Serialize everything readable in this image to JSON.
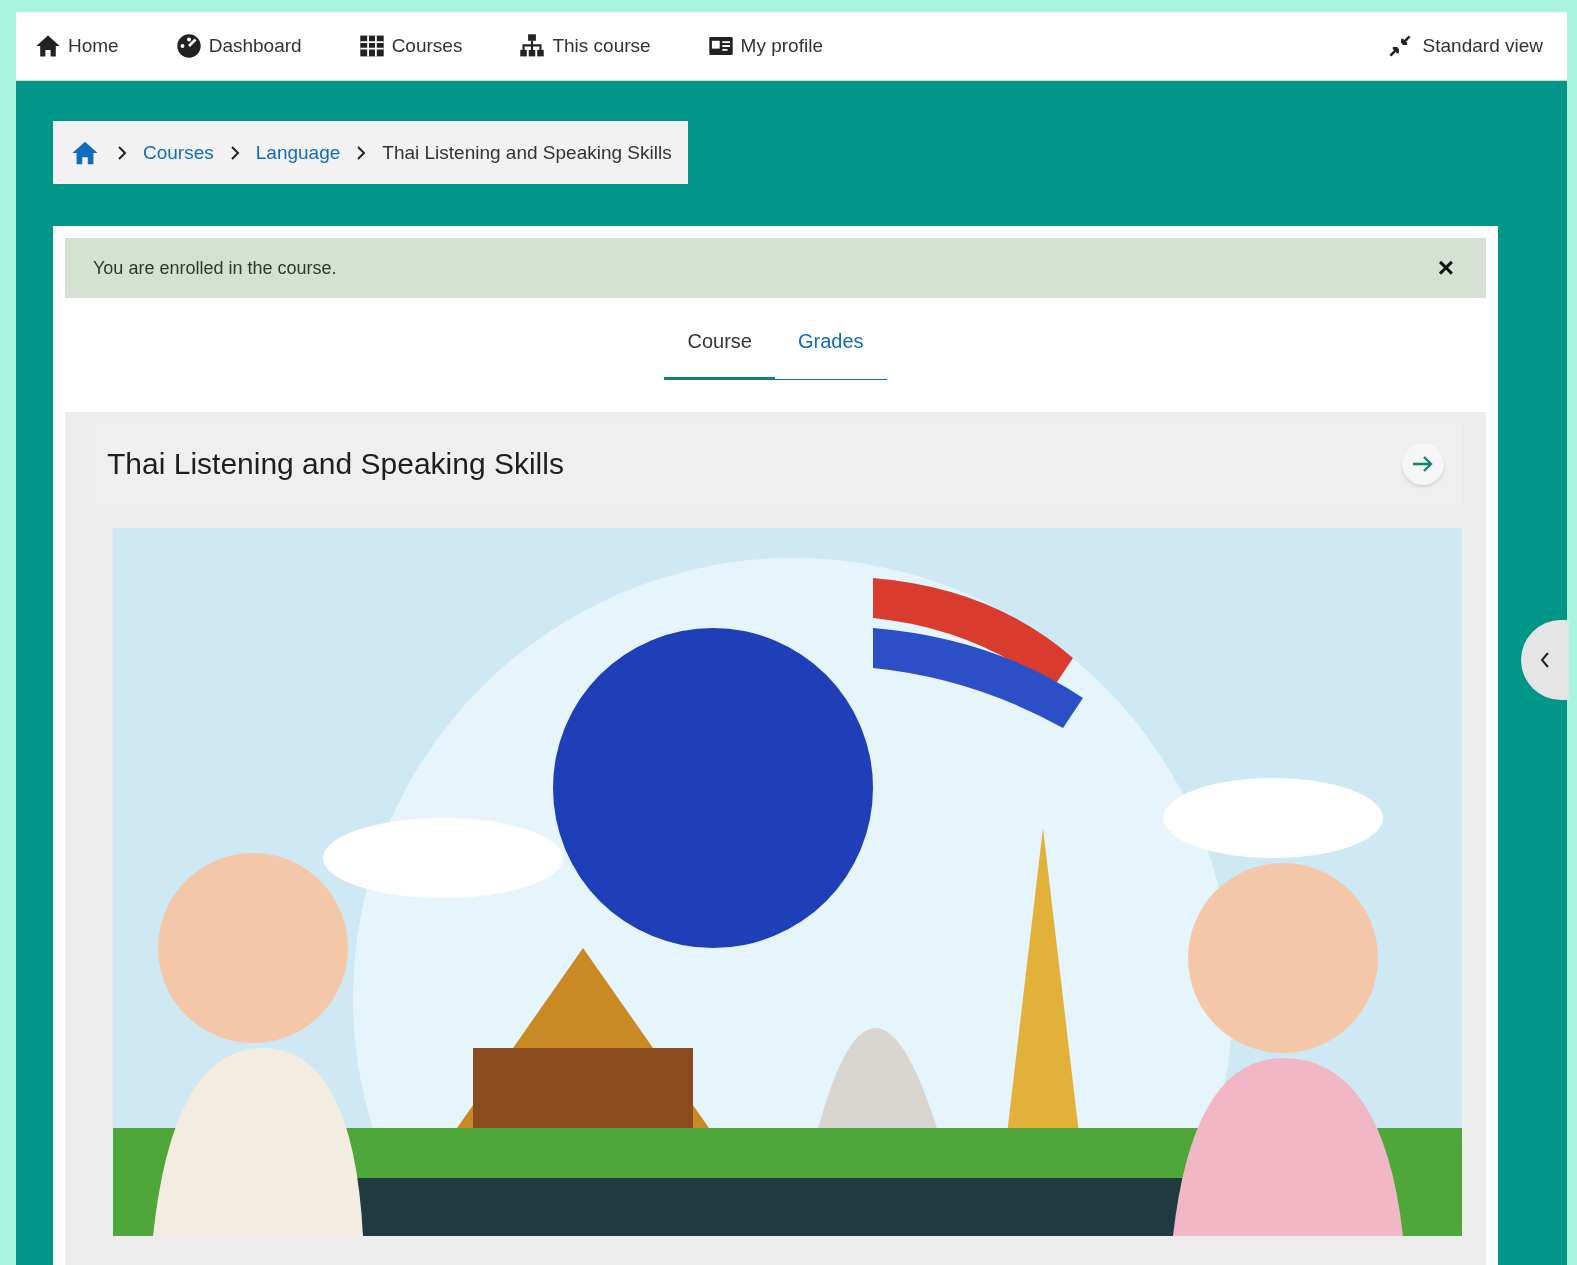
{
  "nav": {
    "items": [
      {
        "label": "Home",
        "kind": "home"
      },
      {
        "label": "Dashboard",
        "kind": "dashboard"
      },
      {
        "label": "Courses",
        "kind": "grid"
      },
      {
        "label": "This course",
        "kind": "sitemap"
      },
      {
        "label": "My profile",
        "kind": "card"
      }
    ],
    "view_toggle": "Standard view"
  },
  "breadcrumb": [
    {
      "label": "Courses",
      "kind": "link"
    },
    {
      "label": "Language",
      "kind": "link"
    },
    {
      "label": "Thai Listening and Speaking Skills",
      "kind": "current"
    }
  ],
  "alert": {
    "message": "You are enrolled in the course.",
    "close": "×"
  },
  "tabs": [
    {
      "label": "Course",
      "selected": true
    },
    {
      "label": "Grades",
      "selected": false
    }
  ],
  "section": {
    "title": "Thai Listening and Speaking Skills"
  }
}
